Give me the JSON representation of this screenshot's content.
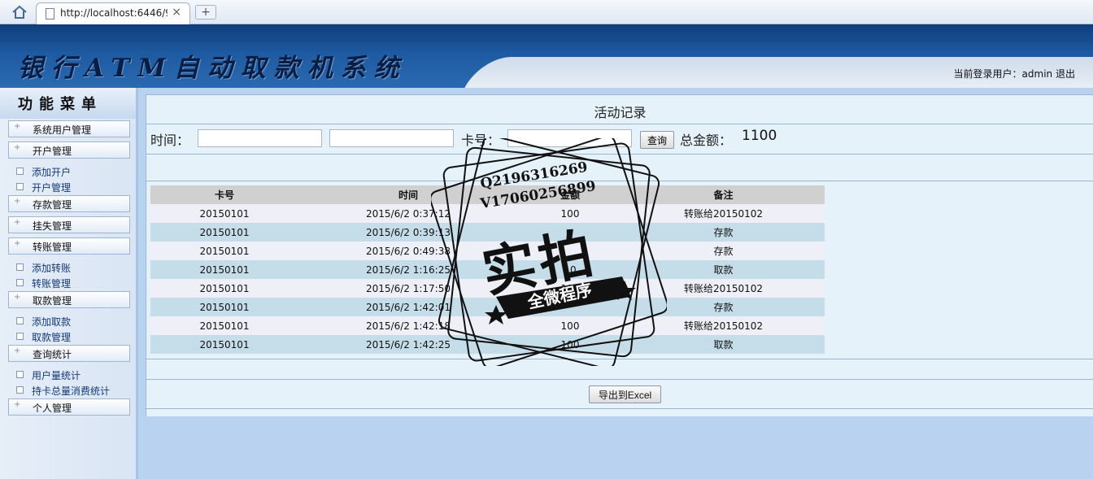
{
  "browser": {
    "url": "http://localhost:6446/9",
    "close_glyph": "×",
    "new_tab_glyph": "+"
  },
  "header": {
    "site_title": "银行ATM自动取款机系统",
    "user_label": "当前登录用户：",
    "username": "admin",
    "logout": "退出"
  },
  "sidebar": {
    "title": "功能菜单",
    "cats": {
      "system_users": "系统用户管理",
      "account_mgmt": "开户管理",
      "deposit_mgmt": "存款管理",
      "loss_mgmt": "挂失管理",
      "transfer_mgmt": "转账管理",
      "withdraw_mgmt": "取款管理",
      "query_stats": "查询统计",
      "personal_mgmt": "个人管理"
    },
    "subs": {
      "add_account": "添加开户",
      "account_mgmt": "开户管理",
      "add_transfer": "添加转账",
      "transfer_mgmt": "转账管理",
      "add_withdraw": "添加取款",
      "withdraw_mgmt": "取款管理",
      "user_stats": "用户量统计",
      "card_consumption_stats": "持卡总量消费统计"
    }
  },
  "main": {
    "title": "活动记录",
    "time_label": "时间：",
    "card_label": "卡号：",
    "time_from": "",
    "time_to": "",
    "card_no": "",
    "query_button": "查询",
    "total_label": "总金额：",
    "total_value": "1100",
    "columns": [
      "卡号",
      "时间",
      "金额",
      "备注"
    ],
    "rows": [
      [
        "20150101",
        "2015/6/2 0:37:12",
        "100",
        "转账给20150102"
      ],
      [
        "20150101",
        "2015/6/2 0:39:13",
        "",
        "存款"
      ],
      [
        "20150101",
        "2015/6/2 0:49:38",
        "",
        "存款"
      ],
      [
        "20150101",
        "2015/6/2 1:16:25",
        "10",
        "取款"
      ],
      [
        "20150101",
        "2015/6/2 1:17:50",
        "100",
        "转账给20150102"
      ],
      [
        "20150101",
        "2015/6/2 1:42:01",
        "",
        "存款"
      ],
      [
        "20150101",
        "2015/6/2 1:42:18",
        "100",
        "转账给20150102"
      ],
      [
        "20150101",
        "2015/6/2 1:42:25",
        "100",
        "取款"
      ]
    ],
    "export_button": "导出到Excel"
  },
  "watermark": {
    "qq": "Q2196316269",
    "vx": "V17060256899",
    "big": "实拍",
    "ribbon": "全微程序"
  }
}
